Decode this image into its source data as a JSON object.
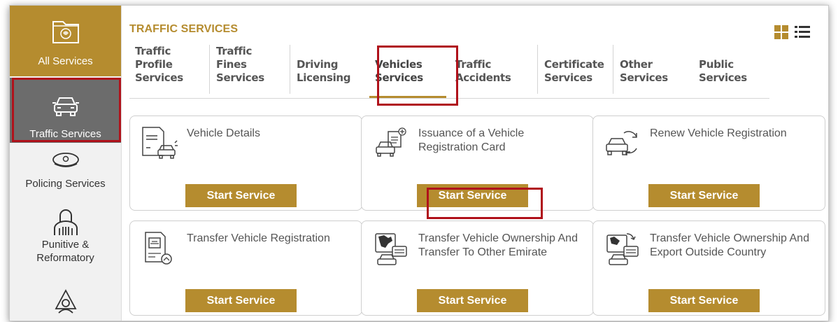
{
  "sidebar": {
    "items": [
      {
        "label": "All Services"
      },
      {
        "label": "Traffic Services"
      },
      {
        "label": "Policing Services"
      },
      {
        "label": "Punitive &\nReformatory"
      },
      {
        "label": ""
      }
    ]
  },
  "main": {
    "section_title": "TRAFFIC SERVICES",
    "view_icons": [
      "grid-view-icon",
      "list-view-icon"
    ],
    "tabs": [
      {
        "label": "Traffic\nProfile\nServices"
      },
      {
        "label": "Traffic\nFines\nServices"
      },
      {
        "label": "Driving\nLicensing"
      },
      {
        "label": "Vehicles\nServices",
        "active": true
      },
      {
        "label": "Traffic\nAccidents"
      },
      {
        "label": "Certificate\nServices"
      },
      {
        "label": "Other\nServices"
      },
      {
        "label": "Public\nServices"
      }
    ],
    "cards": [
      {
        "title": "Vehicle Details",
        "button": "Start Service",
        "icon": "vehicle-details-icon"
      },
      {
        "title": "Issuance of a Vehicle Registration Card",
        "button": "Start Service",
        "icon": "issue-registration-card-icon"
      },
      {
        "title": "Renew Vehicle Registration",
        "button": "Start Service",
        "icon": "renew-registration-icon"
      },
      {
        "title": "Transfer Vehicle Registration",
        "button": "Start Service",
        "icon": "transfer-registration-icon"
      },
      {
        "title": "Transfer Vehicle Ownership And Transfer To Other Emirate",
        "button": "Start Service",
        "icon": "transfer-emirate-icon"
      },
      {
        "title": "Transfer Vehicle Ownership And Export Outside Country",
        "button": "Start Service",
        "icon": "export-outside-country-icon"
      }
    ]
  },
  "colors": {
    "accent_gold": "#b58c2f",
    "sidebar_active": "#6c6c6c",
    "highlight_red": "#b0121b"
  }
}
